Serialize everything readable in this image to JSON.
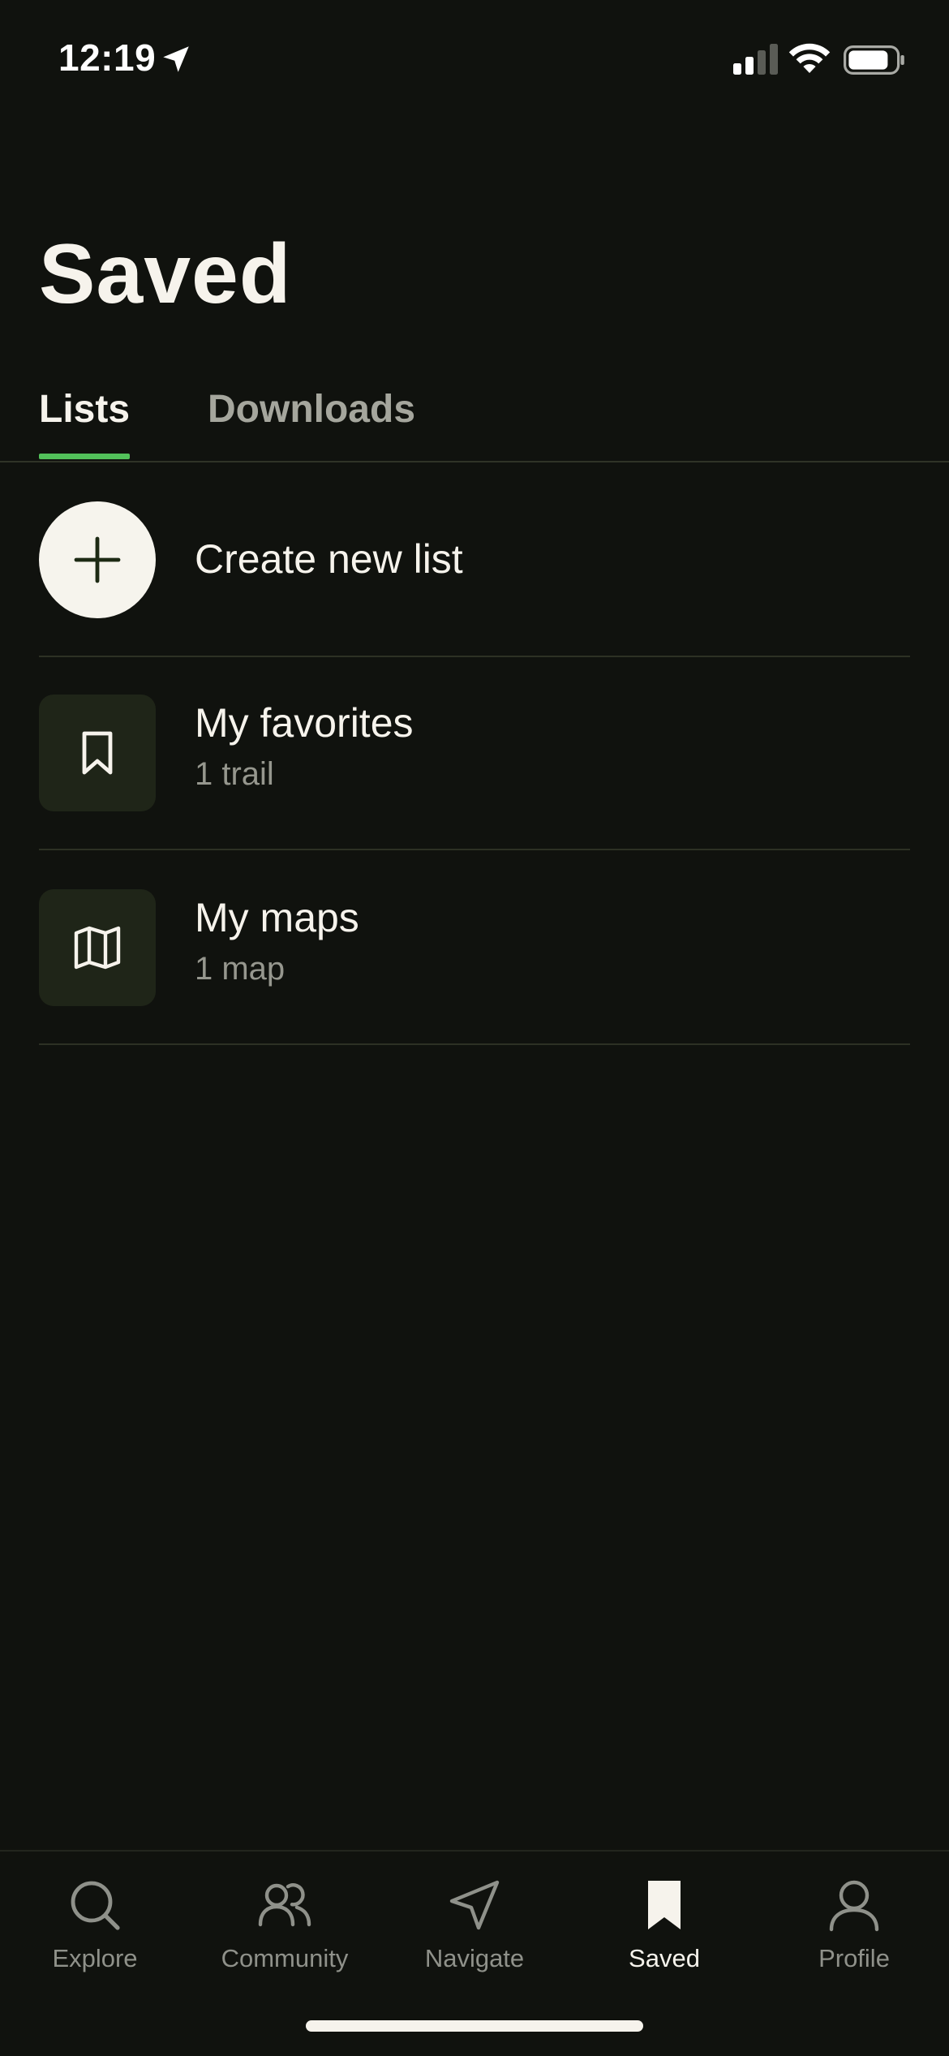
{
  "status_bar": {
    "time": "12:19",
    "location_icon": "location-arrow-icon",
    "signal_icon": "cellular-signal-icon",
    "wifi_icon": "wifi-icon",
    "battery_icon": "battery-icon"
  },
  "header": {
    "title": "Saved"
  },
  "tabs": [
    {
      "label": "Lists",
      "active": true
    },
    {
      "label": "Downloads",
      "active": false
    }
  ],
  "create": {
    "label": "Create new list",
    "icon": "plus-icon"
  },
  "lists": [
    {
      "title": "My favorites",
      "subtitle": "1 trail",
      "icon": "bookmark-icon"
    },
    {
      "title": "My maps",
      "subtitle": "1 map",
      "icon": "map-icon"
    }
  ],
  "nav": [
    {
      "label": "Explore",
      "icon": "search-icon",
      "active": false
    },
    {
      "label": "Community",
      "icon": "community-icon",
      "active": false
    },
    {
      "label": "Navigate",
      "icon": "navigate-icon",
      "active": false
    },
    {
      "label": "Saved",
      "icon": "bookmark-icon",
      "active": true
    },
    {
      "label": "Profile",
      "icon": "profile-icon",
      "active": false
    }
  ],
  "colors": {
    "background": "#10120e",
    "accent": "#52c15a",
    "text_primary": "#f6f3ec",
    "text_secondary": "#96978e",
    "thumb_bg": "#1f2518"
  }
}
